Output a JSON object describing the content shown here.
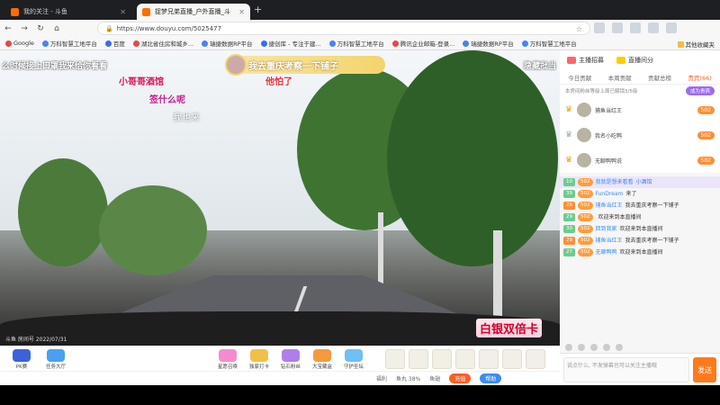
{
  "tabs": [
    {
      "title": "我的关注 - 斗鱼",
      "active": false
    },
    {
      "title": "捉梦兄弟直播_户外直播_斗",
      "active": true
    }
  ],
  "address": {
    "url": "https://www.douyu.com/5025477"
  },
  "bookmarks": [
    "Google",
    "万科智慧工地平台",
    "百度",
    "湖北省住房和城乡...",
    "瑞捷数据RP平台",
    "捷创库 - 专注于建...",
    "万科智慧工地平台",
    "腾讯企业邮箱-登录...",
    "瑞捷数据RP平台",
    "万科智慧工地平台"
  ],
  "bookmarks_other": "其他收藏夹",
  "video": {
    "overlay_left": "么时候接上口罩我来给你看看",
    "overlay_right": "隐藏批当",
    "banner_text": "我去重庆考察一下铺子",
    "danmu": [
      "小哥哥酒馆",
      "签什么呢",
      "我也来",
      "他怕了"
    ],
    "card_badge": "白银双倍卡",
    "watermark": "斗鱼 房间号 2022/07/31"
  },
  "giftbar": {
    "left": [
      "PK赛",
      "任务大厅"
    ],
    "mid": [
      "星愿召唤",
      "独家打卡",
      "钻石粉丝",
      "大宝藏盒",
      "守护圣坛"
    ]
  },
  "status": {
    "items": [
      "福利",
      "鱼丸 38%",
      "鱼翅"
    ],
    "recharge": "充值",
    "help": "帮助"
  },
  "sidebar": {
    "tags": [
      "主播招募",
      "直播间分"
    ],
    "tabs": [
      "今日贡献",
      "本周贡献",
      "贡献总榜",
      "贵宾(66)"
    ],
    "rank_note": "本房间粉丝等级上周已解锁3/5级",
    "rank_btn": "成为贵宾",
    "ranks": [
      {
        "name": "捕鱼当红王",
        "points": "502"
      },
      {
        "name": "我名小吃鸭",
        "points": "502"
      },
      {
        "name": "无聊鸭鸭说",
        "points": "502"
      }
    ],
    "messages": [
      {
        "lv": "10",
        "badge": "502",
        "user": "我就是想来看看",
        "text": "小酒馆",
        "hl": true
      },
      {
        "lv": "39",
        "badge": "502",
        "user": "FunDream",
        "text": "来了",
        "hl": false
      },
      {
        "lv": "29",
        "badge": "502",
        "user": "捕鱼当红王",
        "text": "我去重庆考察一下铺子",
        "hl": false
      },
      {
        "lv": "29",
        "badge": "502",
        "user": "",
        "text": "欢迎来到本直播间",
        "hl": false
      },
      {
        "lv": "30",
        "badge": "502",
        "user": "回到我家",
        "text": "欢迎来到本直播间",
        "hl": false
      },
      {
        "lv": "29",
        "badge": "502",
        "user": "捕鱼当红王",
        "text": "我去重庆考察一下铺子",
        "hl": false
      },
      {
        "lv": "27",
        "badge": "502",
        "user": "无聊鸭鸭",
        "text": "欢迎来到本直播间",
        "hl": false
      }
    ],
    "input_placeholder": "说点什么, 不发弹幕也可以关注主播哦",
    "send": "发送"
  }
}
